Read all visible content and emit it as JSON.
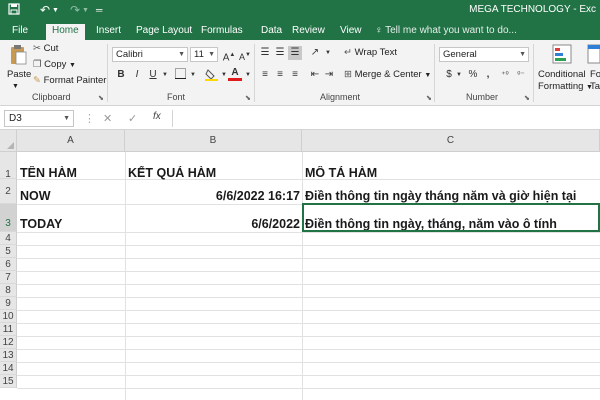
{
  "title_bar": {
    "app_title": "MEGA TECHNOLOGY - Exc",
    "save_icon": "save-icon",
    "undo_icon": "undo-icon",
    "redo_icon": "redo-icon"
  },
  "tabs": [
    {
      "label": "File"
    },
    {
      "label": "Home"
    },
    {
      "label": "Insert"
    },
    {
      "label": "Page Layout"
    },
    {
      "label": "Formulas"
    },
    {
      "label": "Data"
    },
    {
      "label": "Review"
    },
    {
      "label": "View"
    }
  ],
  "tell_me": "Tell me what you want to do...",
  "ribbon": {
    "clipboard": {
      "paste": "Paste",
      "cut": "Cut",
      "copy": "Copy",
      "format_painter": "Format Painter",
      "group_label": "Clipboard"
    },
    "font": {
      "font_name": "Calibri",
      "font_size": "11",
      "grow": "A",
      "shrink": "A",
      "bold": "B",
      "italic": "I",
      "underline": "U",
      "font_color_letter": "A",
      "group_label": "Font"
    },
    "alignment": {
      "wrap_text": "Wrap Text",
      "merge_center": "Merge & Center",
      "group_label": "Alignment"
    },
    "number": {
      "format": "General",
      "currency": "$",
      "percent": "%",
      "comma": ",",
      "group_label": "Number"
    },
    "styles": {
      "conditional_1": "Conditional",
      "conditional_2": "Formatting",
      "format_as_1": "Fo",
      "format_as_2": "Ta"
    }
  },
  "formula_bar": {
    "name_box": "D3",
    "cancel": "✕",
    "enter": "✓",
    "fx": "fx",
    "content": ""
  },
  "columns": [
    "A",
    "B",
    "C"
  ],
  "rows": [
    "1",
    "2",
    "3",
    "4",
    "5",
    "6",
    "7",
    "8",
    "9",
    "10",
    "11",
    "12",
    "13",
    "14",
    "15"
  ],
  "cells": {
    "A1": "TÊN HÀM",
    "B1": "KẾT QUẢ HÀM",
    "C1": "MÔ TẢ HÀM",
    "A2": "NOW",
    "B2": "6/6/2022 16:17",
    "C2": "Điền thông tin ngày tháng năm và giờ hiện tại",
    "A3": "TODAY",
    "B3": "6/6/2022",
    "C3": "Điền thông tin ngày, tháng, năm vào ô tính"
  },
  "colors": {
    "accent": "#217346"
  }
}
